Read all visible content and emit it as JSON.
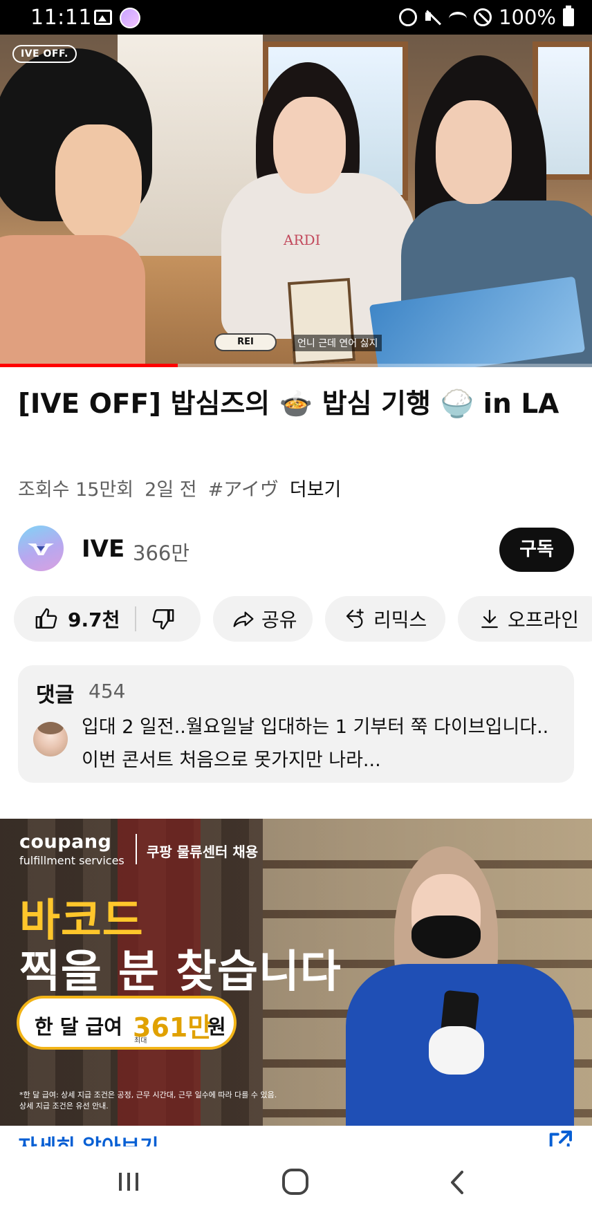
{
  "status_bar": {
    "time": "11:11",
    "battery": "100%"
  },
  "player": {
    "watermark": "IVE OFF.",
    "name_tag": "REI",
    "subtitle": "언니 근데 연어 싫지",
    "progress_fraction": 0.3
  },
  "video": {
    "title": "[IVE OFF] 밥심즈의 🍲 밥심 기행 🍚 in LA",
    "views": "조회수 15만회",
    "age": "2일 전",
    "hashtag": "#アイヴ",
    "more": "더보기"
  },
  "channel": {
    "name": "IVE",
    "subscribers": "366만",
    "subscribe_label": "구독"
  },
  "actions": {
    "like_count": "9.7천",
    "share_label": "공유",
    "remix_label": "리믹스",
    "download_label": "오프라인"
  },
  "comments": {
    "header": "댓글",
    "count": "454",
    "top_comment": "입대 2 일전..월요일날 입대하는 1 기부터 쭉 다이브입니다.. 이번 콘서트 처음으로 못가지만 나라..."
  },
  "ad": {
    "brand": "coupang",
    "brand_sub": "fulfillment services",
    "recruit": "쿠팡 물류센터 채용",
    "headline1": "바코드",
    "headline2": "찍을 분 찾습니다",
    "salary_prefix": "한 달 급여",
    "salary_amount": "361만",
    "salary_unit": "원",
    "salary_max": "최대",
    "disclaimer_line1": "*한 달 급여: 상세 지급 조건은 공정, 근무 시간대, 근무 일수에 따라 다를 수 있음.",
    "disclaimer_line2": "상세 지급 조건은 유선 안내.",
    "learn_more": "자세히 알아보기"
  },
  "colors": {
    "accent_red": "#ff0000",
    "link_blue": "#065fd4",
    "chip_bg": "#f2f2f2",
    "ad_yellow": "#ffc62b"
  },
  "icons": [
    "picture-icon",
    "alarm-icon",
    "mute-icon",
    "wifi-icon",
    "dnd-icon",
    "battery-icon",
    "like-icon",
    "dislike-icon",
    "share-icon",
    "remix-icon",
    "download-icon",
    "external-link-icon",
    "recent-apps-icon",
    "home-icon",
    "back-icon"
  ]
}
